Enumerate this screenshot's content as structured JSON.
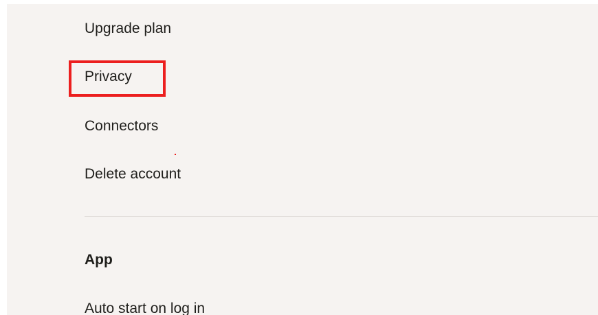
{
  "account_menu": {
    "items": [
      {
        "label": "Upgrade plan"
      },
      {
        "label": "Privacy"
      },
      {
        "label": "Connectors"
      },
      {
        "label": "Delete account"
      }
    ]
  },
  "app_section": {
    "heading": "App",
    "items": [
      {
        "label": "Auto start on log in"
      }
    ]
  },
  "colors": {
    "panel_background": "#f6f3f1",
    "highlight": "#ec1f1f",
    "text": "#1f1e1b"
  }
}
